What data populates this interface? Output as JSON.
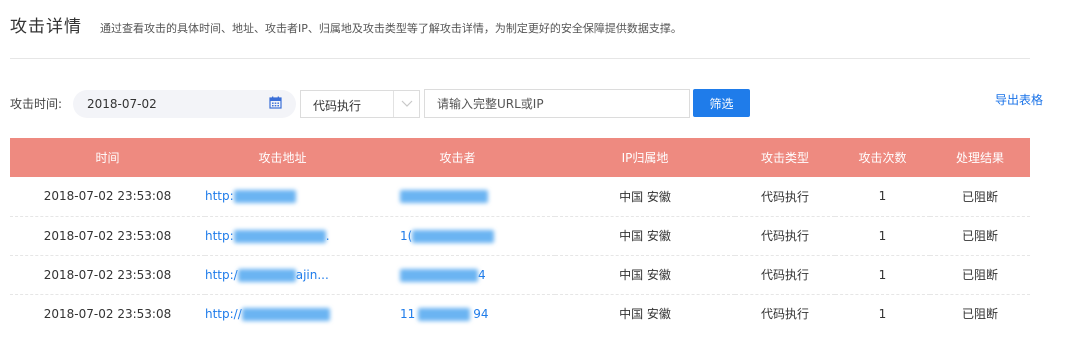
{
  "header": {
    "title": "攻击详情",
    "description": "通过查看攻击的具体时间、地址、攻击者IP、归属地及攻击类型等了解攻击详情，为制定更好的安全保障提供数据支撑。"
  },
  "filter": {
    "time_label": "攻击时间:",
    "date_value": "2018-07-02",
    "type_value": "代码执行",
    "url_placeholder": "请输入完整URL或IP",
    "filter_button": "筛选",
    "export_link": "导出表格"
  },
  "table": {
    "columns": [
      "时间",
      "攻击地址",
      "攻击者",
      "IP归属地",
      "攻击类型",
      "攻击次数",
      "处理结果"
    ],
    "rows": [
      {
        "time": "2018-07-02 23:53:08",
        "url_prefix": "http:",
        "url_suffix": "",
        "attacker_prefix": "",
        "attacker_suffix": "",
        "location": "中国 安徽",
        "type": "代码执行",
        "count": "1",
        "result": "已阻断"
      },
      {
        "time": "2018-07-02 23:53:08",
        "url_prefix": "http:",
        "url_suffix": ".",
        "attacker_prefix": "1(",
        "attacker_suffix": "",
        "location": "中国 安徽",
        "type": "代码执行",
        "count": "1",
        "result": "已阻断"
      },
      {
        "time": "2018-07-02 23:53:08",
        "url_prefix": "http:/",
        "url_suffix": "ajin...",
        "attacker_prefix": "",
        "attacker_suffix": "4",
        "location": "中国 安徽",
        "type": "代码执行",
        "count": "1",
        "result": "已阻断"
      },
      {
        "time": "2018-07-02 23:53:08",
        "url_prefix": "http://",
        "url_suffix": "",
        "attacker_prefix": "11",
        "attacker_suffix": "94",
        "location": "中国 安徽",
        "type": "代码执行",
        "count": "1",
        "result": "已阻断"
      }
    ]
  },
  "colors": {
    "table_header": "#ee8a80",
    "accent": "#1f7cea"
  },
  "icons": {
    "date_picker": "calendar-icon",
    "select": "chevron-down-icon"
  }
}
